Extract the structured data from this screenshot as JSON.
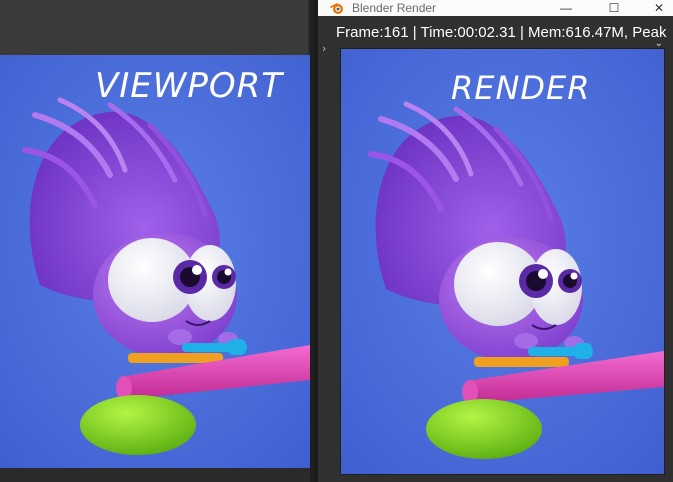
{
  "viewport": {
    "annotation": "VIEWPORT"
  },
  "render_window": {
    "title": "Blender Render",
    "stats": "Frame:161 | Time:00:02.31 | Mem:616.47M, Peak",
    "annotation": "RENDER",
    "controls": {
      "minimize": "—",
      "maximize": "☐",
      "close": "✕"
    }
  },
  "colors": {
    "background_blue": "#4a6fdb",
    "hair_purple": "#8a48d8",
    "body_purple": "#a25ee0",
    "perch_pink": "#e03aa8",
    "blob_green": "#7ed321",
    "scarf_orange": "#f0a020",
    "toy_cyan": "#20b0e8"
  }
}
